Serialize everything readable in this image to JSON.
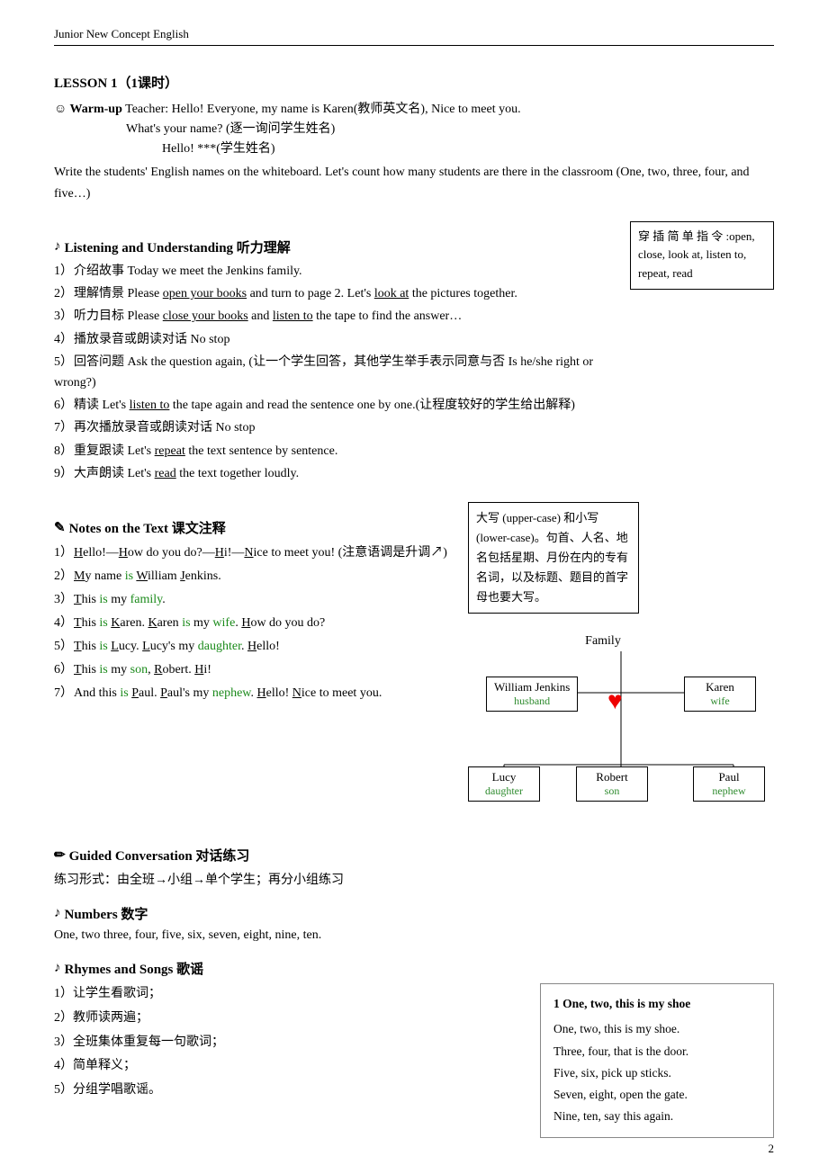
{
  "header": {
    "title": "Junior New Concept English",
    "page": "2"
  },
  "lesson": {
    "title": "LESSON 1（1课时）",
    "warmup": {
      "label": "☺ Warm-up",
      "line1": "Teacher: Hello! Everyone, my name is Karen(教师英文名), Nice to meet you.",
      "line2": "What's your name? (逐一询问学生姓名)",
      "line3": "Hello! ***(学生姓名)",
      "line4": "Write the students' English names on the whiteboard. Let's count how many students are there in the classroom (One, two, three, four, and five…)"
    },
    "listening": {
      "sectionTitle": "Listening and Understanding  听力理解",
      "items": [
        "介绍故事  Today we meet the Jenkins family.",
        "理解情景  Please open your books and turn to page 2. Let's look at the pictures together.",
        "听力目标  Please close your books and listen to the tape to find the answer…",
        "播放录音或朗读对话  No stop",
        "回答问题  Ask the question again, (让一个学生回答，其他学生举手表示同意与否 Is he/she right or wrong?)",
        "精读  Let's listen to the tape again and read the sentence one by one.(让程度较好的学生给出解释)",
        "再次播放录音或朗读对话  No stop",
        "重复跟读  Let's repeat the text sentence by sentence.",
        "大声朗读  Let's read the text together loudly."
      ],
      "sideBox": {
        "line1": "穿 插 简 单 指",
        "line2": "令 :open,  close,",
        "line3": "look at, listen to,",
        "line4": "repeat, read"
      }
    },
    "notes": {
      "sectionTitle": "Notes on the Text 课文注释",
      "items": [
        "Hello!—How do you do?—Hi!—Nice to meet you! (注意语调是升调↗)",
        "My name is William Jenkins.",
        "This is my family.",
        "This is Karen. Karen is my wife. How do you do?",
        "This is Lucy. Lucy's my daughter. Hello!",
        "This is my son, Robert. Hi!",
        "And this is Paul. Paul's my nephew. Hello! Nice to meet you."
      ],
      "sideBox": {
        "content": "大写 (upper-case) 和小写 (lower-case)。句首、人名、地名包括星期、月份在内的专有名词，以及标题、题目的首字母也要大写。"
      }
    },
    "familyTree": {
      "family": "Family",
      "william": {
        "name": "William Jenkins",
        "role": "husband"
      },
      "karen": {
        "name": "Karen",
        "role": "wife"
      },
      "lucy": {
        "name": "Lucy",
        "role": "daughter"
      },
      "robert": {
        "name": "Robert",
        "role": "son"
      },
      "paul": {
        "name": "Paul",
        "role": "nephew"
      }
    },
    "guided": {
      "sectionTitle": "Guided Conversation 对话练习",
      "text": "练习形式：由全班→小组→单个学生；再分小组练习"
    },
    "numbers": {
      "sectionTitle": "Numbers  数字",
      "text": "One, two three, four, five, six, seven, eight, nine, ten."
    },
    "rhymes": {
      "sectionTitle": "Rhymes and Songs  歌谣",
      "items": [
        "让学生看歌词；",
        "教师读两遍；",
        "全班集体重复每一句歌词；",
        "简单释义；",
        "分组学唱歌谣。"
      ],
      "songTitle": "1 One, two, this is my shoe",
      "songLines": [
        "One, two, this is my shoe.",
        "Three, four, that is the door.",
        "Five, six, pick up sticks.",
        "Seven, eight, open the gate.",
        "Nine, ten, say this again."
      ]
    }
  }
}
